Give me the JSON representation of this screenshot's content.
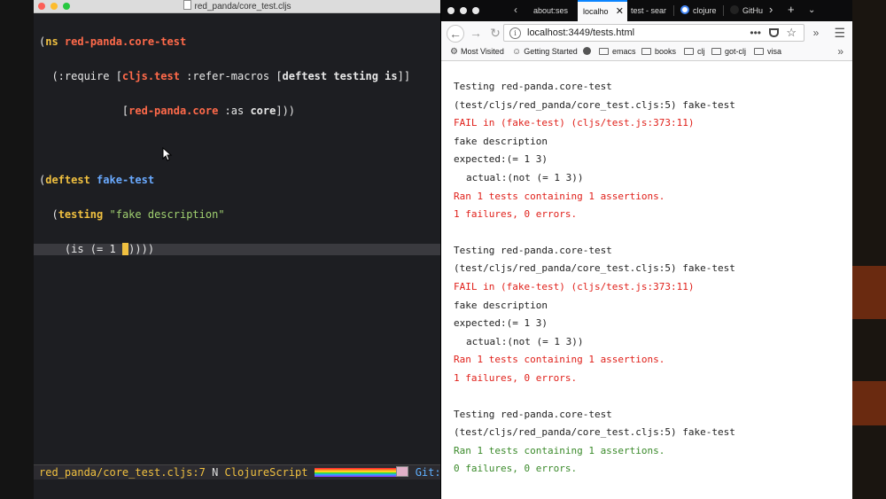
{
  "editor": {
    "title": "red_panda/core_test.cljs",
    "code": {
      "l1_open": "(",
      "l1_kw": "ns",
      "l1_space": " ",
      "l1_ns": "red-panda.core-test",
      "l2_a": "  (:require [",
      "l2_ns": "cljs.test",
      "l2_b": " :refer-macros [",
      "l2_c": "deftest testing is",
      "l2_d": "]]",
      "l3_a": "             [",
      "l3_ns": "red-panda.core",
      "l3_b": " :as ",
      "l3_c": "core",
      "l3_d": "]))",
      "l5_open": "(",
      "l5_kw": "deftest",
      "l5_space": " ",
      "l5_fn": "fake-test",
      "l6_a": "  (",
      "l6_kw": "testing",
      "l6_space": " ",
      "l6_str": "\"fake description\"",
      "l7_a": "    (is (= 1 ",
      "l7_cursor": " ",
      "l7_b": "))))"
    },
    "modeline": {
      "file": "red_panda/core_test.cljs:7",
      "state": "N",
      "mode": "ClojureScript",
      "git": "Git:tes"
    }
  },
  "browser": {
    "tabs": [
      {
        "label": "about:ses"
      },
      {
        "label": "localho",
        "active": true
      },
      {
        "label": "test - sear"
      },
      {
        "label": "clojure"
      },
      {
        "label": "GitHu"
      }
    ],
    "url": "localhost:3449/tests.html",
    "bookmarks": [
      "Most Visited",
      "Getting Started",
      "emacs",
      "books",
      "clj",
      "got-clj",
      "visa"
    ],
    "output": [
      {
        "lines": [
          {
            "text": "Testing red-panda.core-test",
            "kind": "normal"
          },
          {
            "text": "(test/cljs/red_panda/core_test.cljs:5) fake-test",
            "kind": "normal"
          },
          {
            "text": "FAIL in (fake-test) (cljs/test.js:373:11)",
            "kind": "fail"
          },
          {
            "text": "fake description",
            "kind": "normal"
          },
          {
            "text": "expected:(= 1 3)",
            "kind": "normal"
          },
          {
            "text": "actual:(not (= 1 3))",
            "kind": "indent"
          },
          {
            "text": "Ran 1 tests containing 1 assertions.",
            "kind": "fail"
          },
          {
            "text": "1 failures, 0 errors.",
            "kind": "fail"
          }
        ]
      },
      {
        "lines": [
          {
            "text": "Testing red-panda.core-test",
            "kind": "normal"
          },
          {
            "text": "(test/cljs/red_panda/core_test.cljs:5) fake-test",
            "kind": "normal"
          },
          {
            "text": "FAIL in (fake-test) (cljs/test.js:373:11)",
            "kind": "fail"
          },
          {
            "text": "fake description",
            "kind": "normal"
          },
          {
            "text": "expected:(= 1 3)",
            "kind": "normal"
          },
          {
            "text": "actual:(not (= 1 3))",
            "kind": "indent"
          },
          {
            "text": "Ran 1 tests containing 1 assertions.",
            "kind": "fail"
          },
          {
            "text": "1 failures, 0 errors.",
            "kind": "fail"
          }
        ]
      },
      {
        "lines": [
          {
            "text": "Testing red-panda.core-test",
            "kind": "normal"
          },
          {
            "text": "(test/cljs/red_panda/core_test.cljs:5) fake-test",
            "kind": "normal"
          },
          {
            "text": "Ran 1 tests containing 1 assertions.",
            "kind": "pass"
          },
          {
            "text": "0 failures, 0 errors.",
            "kind": "pass"
          }
        ]
      }
    ]
  }
}
